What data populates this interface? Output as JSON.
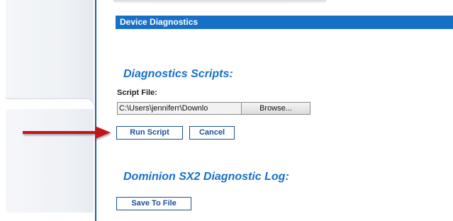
{
  "header": {
    "title": "Device Diagnostics"
  },
  "scripts_section": {
    "title": "Diagnostics Scripts:",
    "file_label": "Script File:",
    "file_value": "C:\\Users\\jenniferr\\Downlo",
    "browse_label": "Browse...",
    "run_label": "Run Script",
    "cancel_label": "Cancel"
  },
  "log_section": {
    "title": "Dominion SX2 Diagnostic Log:",
    "save_label": "Save To File"
  },
  "colors": {
    "accent": "#1770c7",
    "arrow": "#c0141a"
  },
  "icons": {
    "annotation_arrow": "arrow-right-icon"
  }
}
